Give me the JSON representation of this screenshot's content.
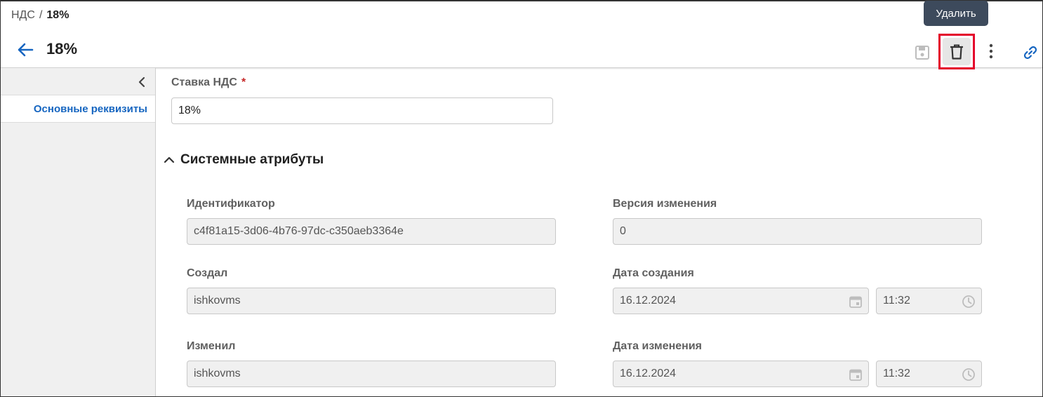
{
  "breadcrumb": {
    "parent": "НДС",
    "separator": "/",
    "current": "18%"
  },
  "header": {
    "title": "18%"
  },
  "toolbar": {
    "delete_tooltip": "Удалить"
  },
  "sidebar": {
    "items": [
      {
        "label": "Основные реквизиты"
      }
    ]
  },
  "form": {
    "vat_rate": {
      "label": "Ставка НДС",
      "required_mark": "*",
      "value": "18%"
    }
  },
  "system_attributes": {
    "title": "Системные атрибуты",
    "identifier": {
      "label": "Идентификатор",
      "value": "c4f81a15-3d06-4b76-97dc-c350aeb3364e"
    },
    "version": {
      "label": "Версия изменения",
      "value": "0"
    },
    "created_by": {
      "label": "Создал",
      "value": "ishkovms"
    },
    "created_at": {
      "label": "Дата создания",
      "date": "16.12.2024",
      "time": "11:32"
    },
    "modified_by": {
      "label": "Изменил",
      "value": "ishkovms"
    },
    "modified_at": {
      "label": "Дата изменения",
      "date": "16.12.2024",
      "time": "11:32"
    }
  },
  "colors": {
    "accent": "#1565c0",
    "highlight": "#e4002b",
    "tooltip_bg": "#3d4a5c"
  }
}
